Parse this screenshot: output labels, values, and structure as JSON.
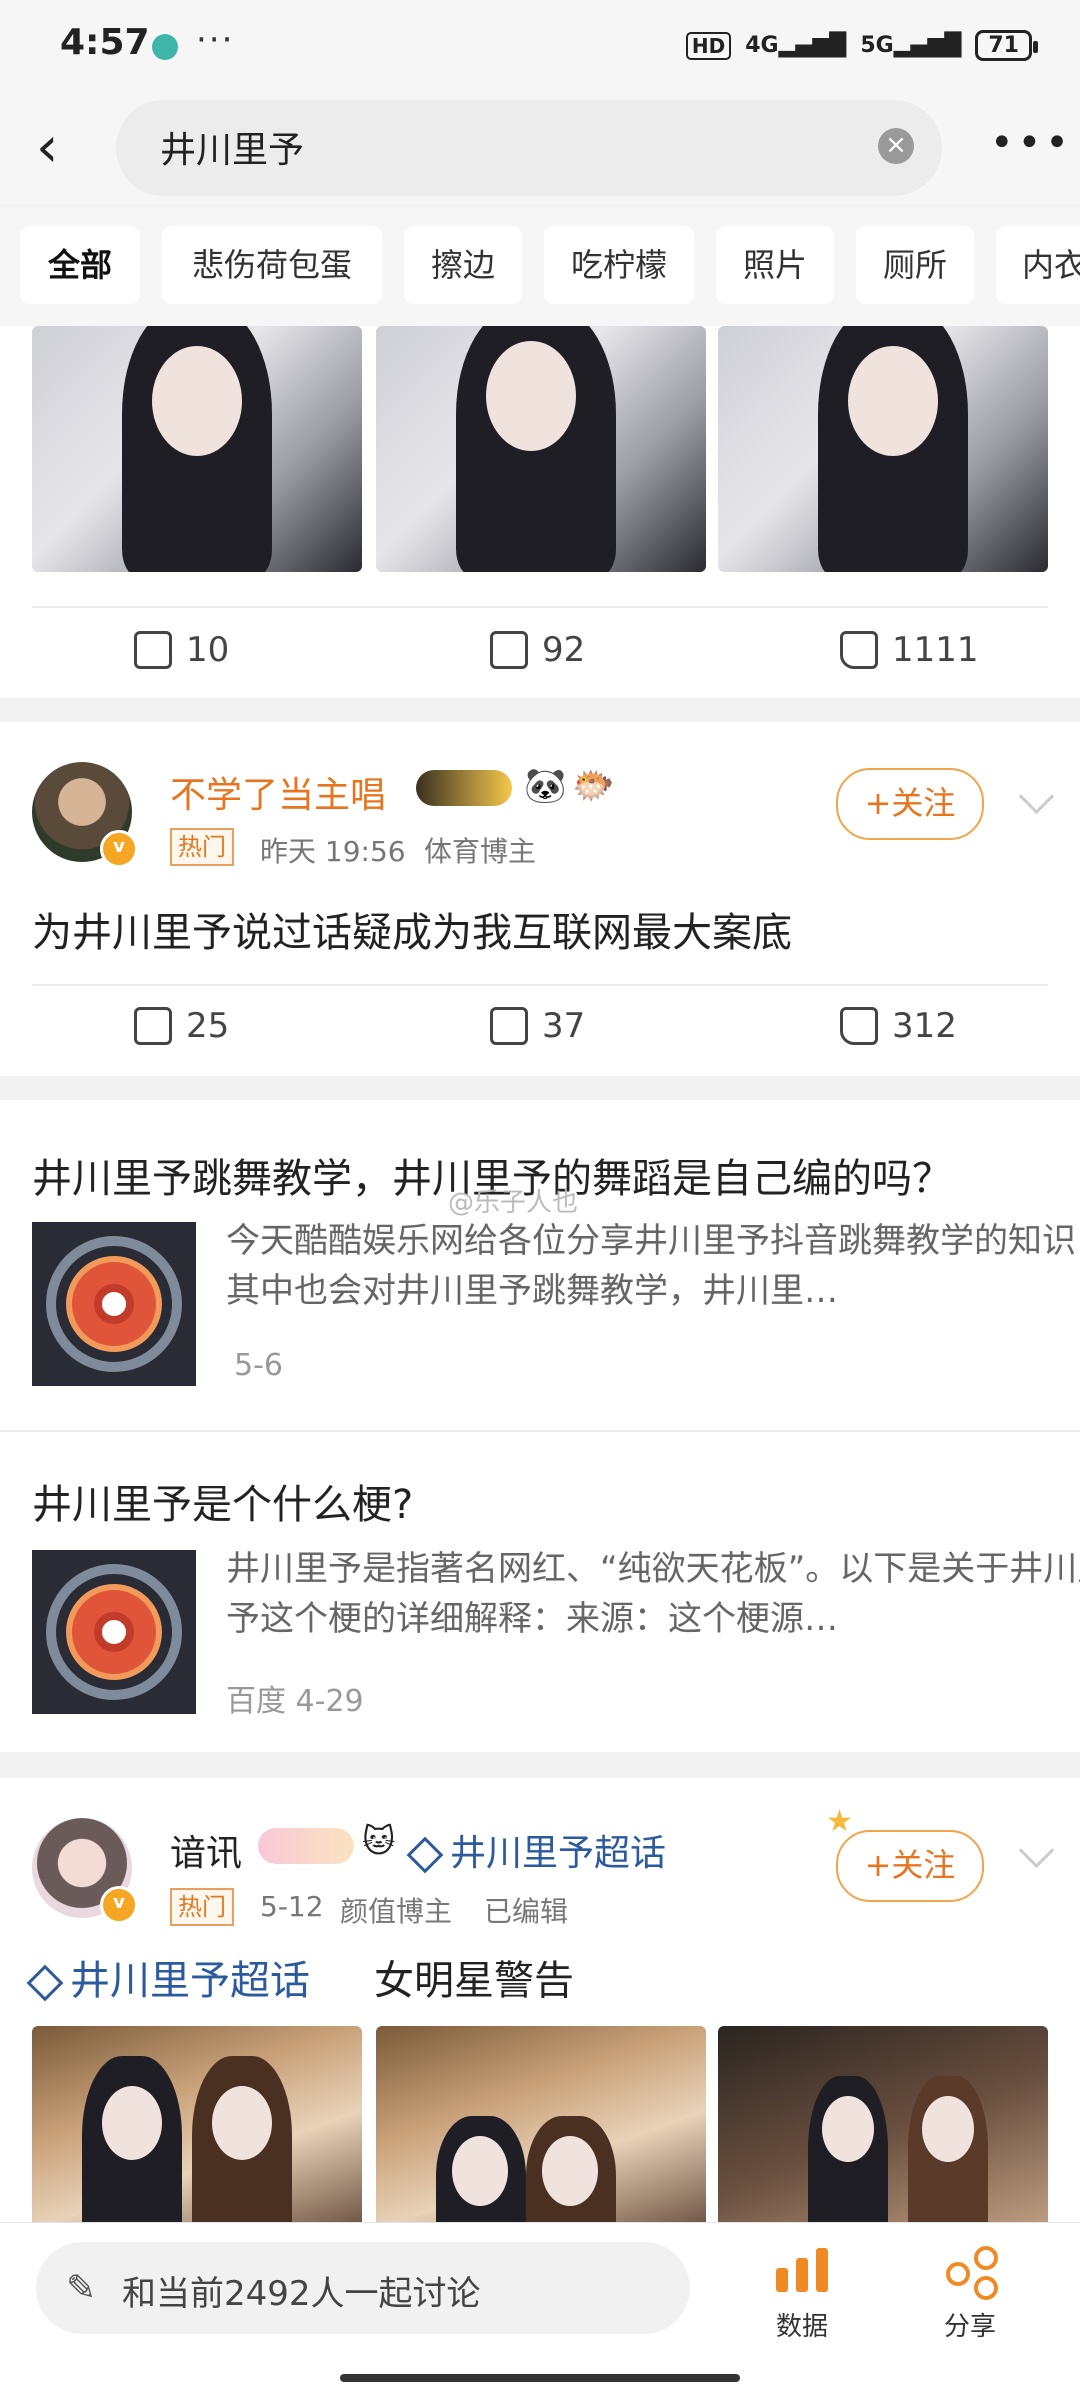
{
  "status": {
    "time": "4:57",
    "more": "···",
    "hd": "HD",
    "net1": "4G",
    "net2": "5G",
    "battery": "71"
  },
  "search": {
    "query": "井川里予",
    "clear": "×",
    "more": "•••"
  },
  "filters": [
    "全部",
    "悲伤荷包蛋",
    "擦边",
    "吃柠檬",
    "照片",
    "厕所",
    "内衣"
  ],
  "post1": {
    "reposts": "10",
    "comments": "92",
    "likes": "1111"
  },
  "post2": {
    "username": "不学了当主唱",
    "badge": "热门",
    "time": "昨天 19:56",
    "tag": "体育博主",
    "follow": "+关注",
    "text": "为井川里予说过话疑成为我互联网最大案底",
    "reposts": "25",
    "comments": "37",
    "likes": "312"
  },
  "article1": {
    "title": "井川里予跳舞教学，井川里予的舞蹈是自己编的吗？",
    "desc": "今天酷酷娱乐网给各位分享井川里予抖音跳舞教学的知识，其中也会对井川里予跳舞教学，井川里…",
    "date": "5-6",
    "watermark": "@乐子人也"
  },
  "article2": {
    "title": "井川里予是个什么梗?",
    "desc": "井川里予是指著名网红、“纯欲天花板”。以下是关于井川里予这个梗的详细解释：来源：这个梗源…",
    "date": "百度 4-29"
  },
  "post3": {
    "username": "谙讯",
    "topic": "井川里予超话",
    "badge": "热门",
    "time": "5-12",
    "tag": "颜值博主",
    "edited": "已编辑",
    "follow": "+关注",
    "text_topic": "井川里予超话",
    "text": "女明星警告"
  },
  "bottom": {
    "input": "和当前2492人一起讨论",
    "data": "数据",
    "share": "分享"
  }
}
